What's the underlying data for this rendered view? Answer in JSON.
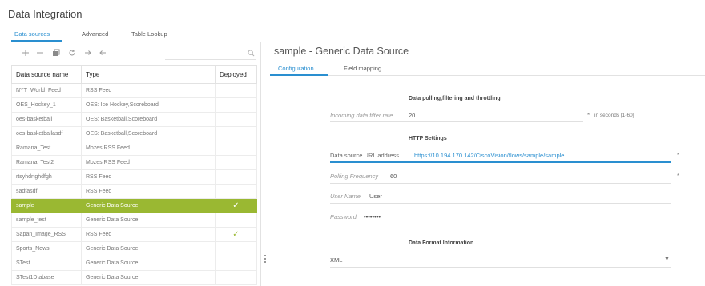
{
  "app": {
    "title": "Data Integration"
  },
  "main_tabs": [
    {
      "label": "Data sources",
      "active": true
    },
    {
      "label": "Advanced",
      "active": false
    },
    {
      "label": "Table Lookup",
      "active": false
    }
  ],
  "toolbar": {
    "icons": [
      "plus-icon",
      "minus-icon",
      "copy-icon",
      "refresh-icon",
      "import-icon",
      "export-icon"
    ],
    "search_placeholder": ""
  },
  "table": {
    "headers": [
      "Data source name",
      "Type",
      "Deployed"
    ],
    "rows": [
      {
        "name": "NYT_World_Feed",
        "type": "RSS Feed",
        "deployed": ""
      },
      {
        "name": "OES_Hockey_1",
        "type": "OES: Ice Hockey,Scoreboard",
        "deployed": ""
      },
      {
        "name": "oes-basketball",
        "type": "OES: Basketball,Scoreboard",
        "deployed": ""
      },
      {
        "name": "oes-basketballasdf",
        "type": "OES: Basketball,Scoreboard",
        "deployed": ""
      },
      {
        "name": "Ramana_Test",
        "type": "Mozes RSS Feed",
        "deployed": ""
      },
      {
        "name": "Ramana_Test2",
        "type": "Mozes RSS Feed",
        "deployed": ""
      },
      {
        "name": "rtsyhdrtghdfgh",
        "type": "RSS Feed",
        "deployed": ""
      },
      {
        "name": "sadfasdf",
        "type": "RSS Feed",
        "deployed": ""
      },
      {
        "name": "sample",
        "type": "Generic Data Source",
        "deployed": "✓"
      },
      {
        "name": "sample_test",
        "type": "Generic Data Source",
        "deployed": ""
      },
      {
        "name": "Sapan_Image_RSS",
        "type": "RSS Feed",
        "deployed": "✓"
      },
      {
        "name": "Sports_News",
        "type": "Generic Data Source",
        "deployed": ""
      },
      {
        "name": "STest",
        "type": "Generic Data Source",
        "deployed": ""
      },
      {
        "name": "STest1Dtabase",
        "type": "Generic Data Source",
        "deployed": ""
      }
    ],
    "selected_row": "sample"
  },
  "detail": {
    "title": "sample - Generic Data Source",
    "tabs": [
      {
        "label": "Configuration",
        "active": true
      },
      {
        "label": "Field mapping",
        "active": false
      }
    ],
    "polling_section": {
      "title": "Data polling,filtering and throttling",
      "filter_rate_label": "Incoming data filter rate",
      "filter_rate_value": "20",
      "filter_rate_unit": "in seconds [1-60]",
      "required_mark": "*"
    },
    "http_section": {
      "title": "HTTP Settings",
      "url_label": "Data source URL address",
      "url_value": "https://10.194.170.142/CiscoVision/flows/sample/sample",
      "polling_label": "Polling Frequency",
      "polling_value": "60",
      "username_label": "User Name",
      "username_value": "User",
      "password_label": "Password",
      "password_value": "••••••••",
      "required_mark": "*"
    },
    "format_section": {
      "title": "Data Format Information",
      "format_value": "XML"
    }
  },
  "colors": {
    "accent": "#2a8fd0",
    "selected_row": "#9ab832",
    "check": "#9ab832"
  }
}
